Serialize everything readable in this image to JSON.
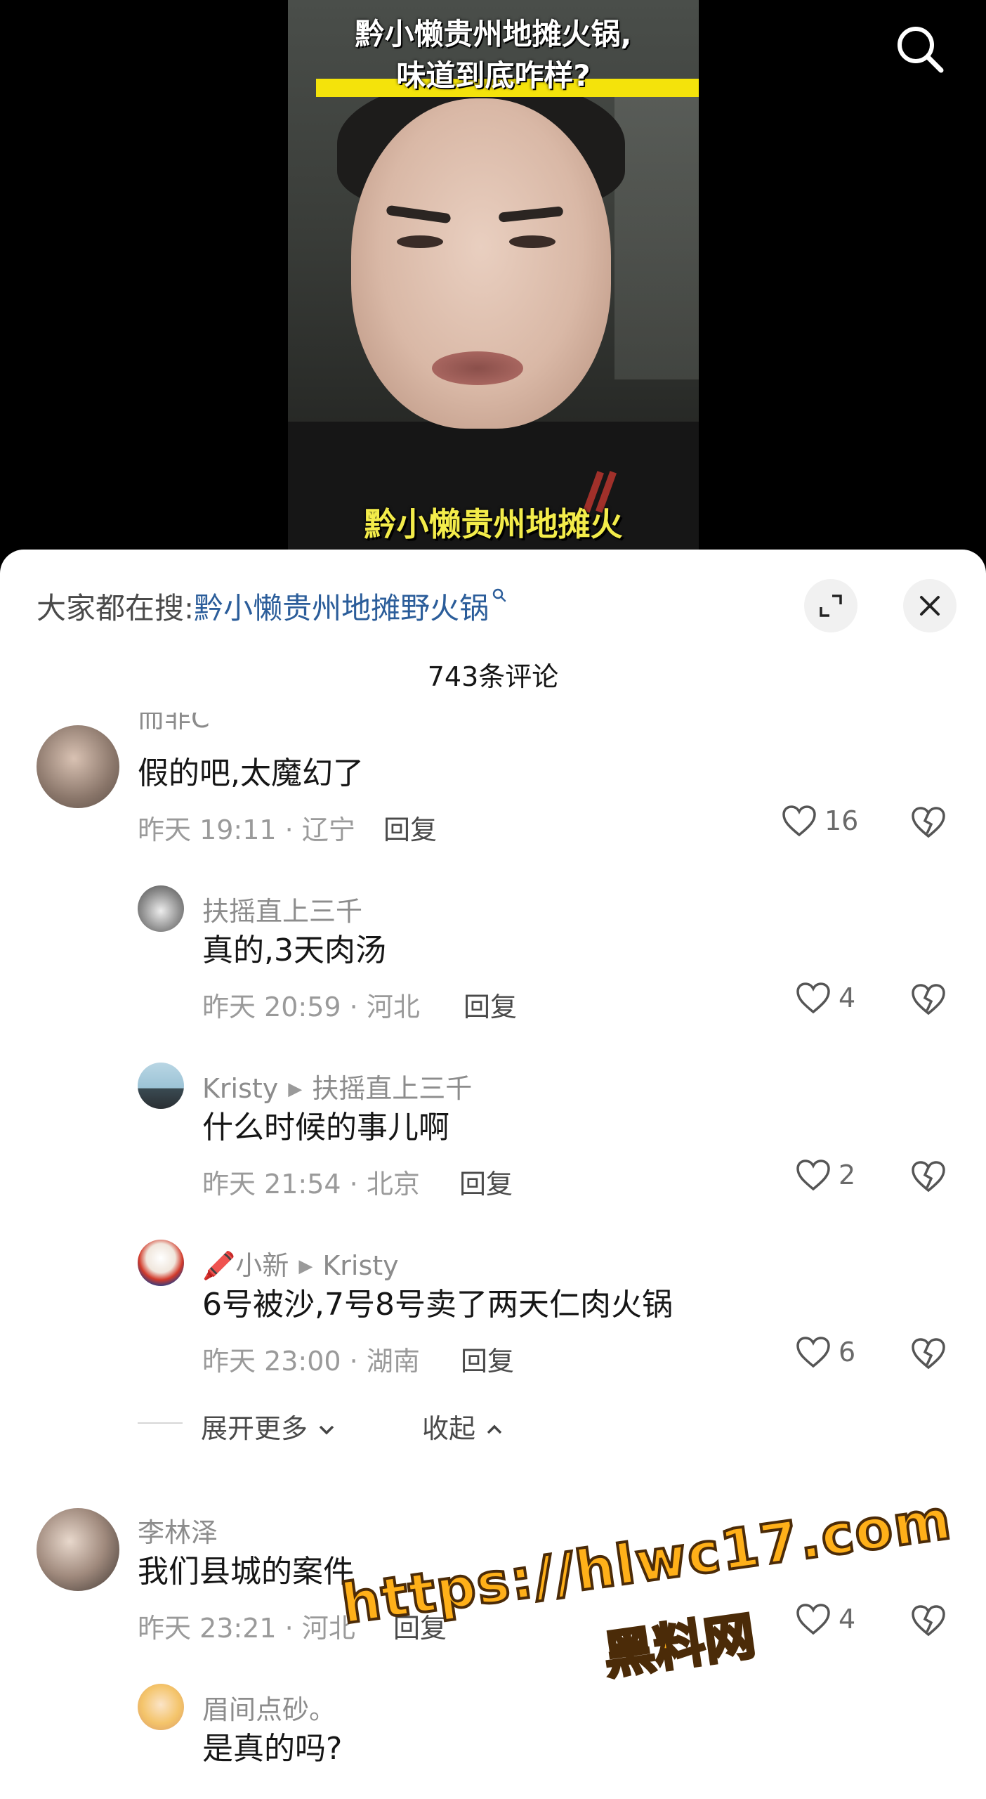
{
  "video": {
    "title_line1": "黔小懒贵州地摊火锅,",
    "title_line2": "味道到底咋样?",
    "caption": "黔小懒贵州地摊火"
  },
  "panel": {
    "suggest_label": "大家都在搜:",
    "suggest_keyword": "黔小懒贵州地摊野火锅",
    "comment_count": "743条评论"
  },
  "comments": [
    {
      "user": "而非C",
      "text": "假的吧,太魔幻了",
      "meta": "昨天 19:11 · 辽宁",
      "reply": "回复",
      "likes": "16"
    },
    {
      "user": "扶摇直上三千",
      "text": "真的,3天肉汤",
      "meta": "昨天 20:59 · 河北",
      "reply": "回复",
      "likes": "4"
    },
    {
      "user": "Kristy",
      "reply_to": "扶摇直上三千",
      "text": "什么时候的事儿啊",
      "meta": "昨天 21:54 · 北京",
      "reply": "回复",
      "likes": "2"
    },
    {
      "user_emoji": "🖍️",
      "user": "小新",
      "reply_to": "Kristy",
      "text": "6号被沙,7号8号卖了两天仁肉火锅",
      "meta": "昨天 23:00 · 湖南",
      "reply": "回复",
      "likes": "6"
    },
    {
      "user": "李林泽",
      "text": "我们县城的案件",
      "meta": "昨天 23:21 · 河北",
      "reply": "回复",
      "likes": "4"
    },
    {
      "user": "眉间点砂。",
      "text": "是真的吗?"
    }
  ],
  "thread_controls": {
    "expand_more": "展开更多",
    "collapse": "收起"
  },
  "watermark": {
    "url": "https://hlwc17.com",
    "site": "黑料网"
  },
  "colors": {
    "accent_blue": "#2b5d9a",
    "caption_yellow": "#f3ec4a",
    "watermark_orange": "#ffb019"
  }
}
